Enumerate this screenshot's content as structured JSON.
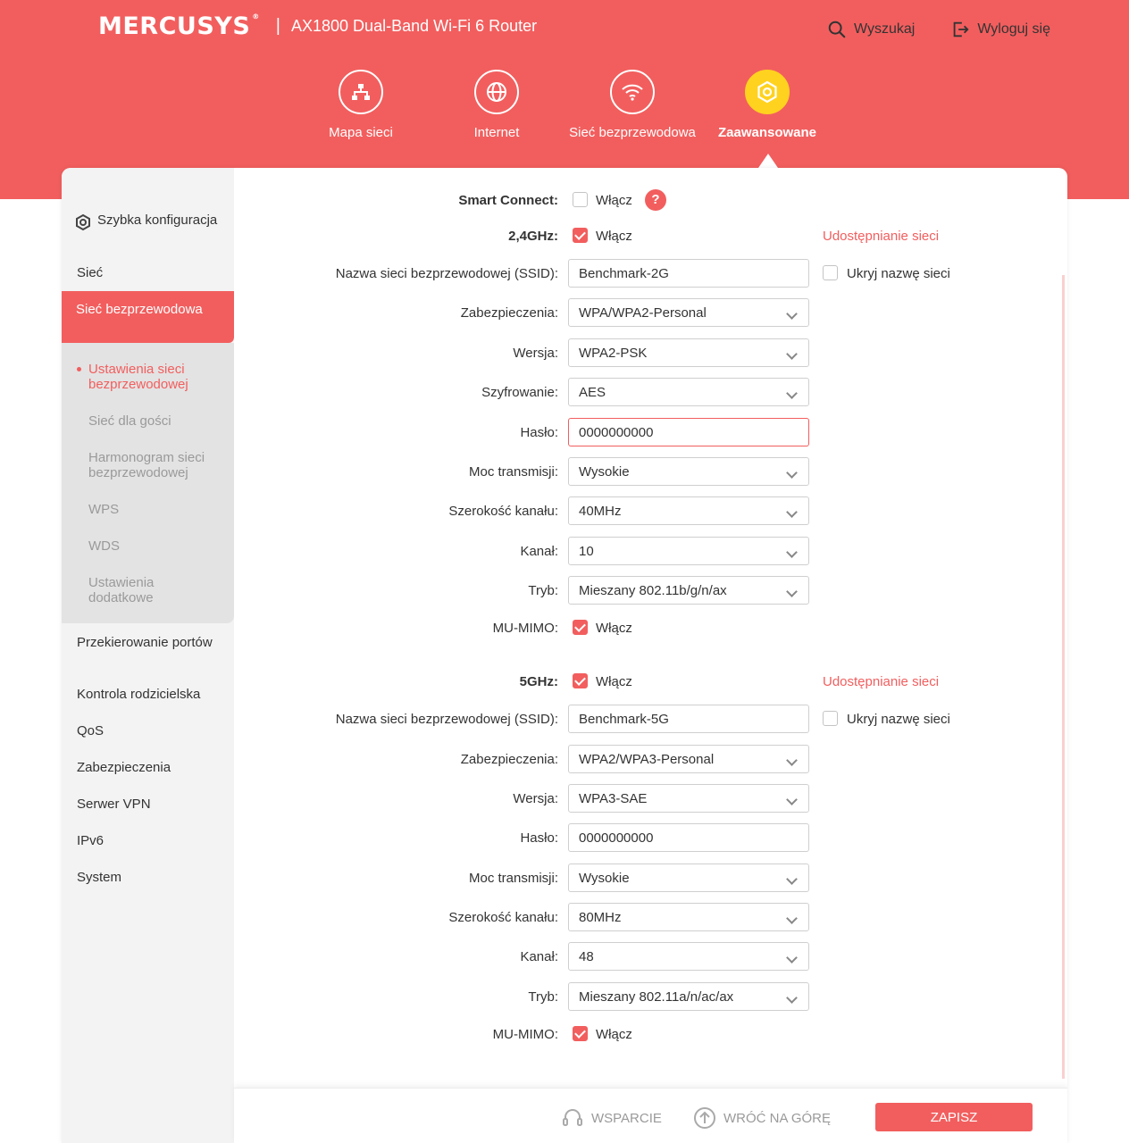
{
  "header": {
    "logo": "MERCUSYS",
    "product": "AX1800 Dual-Band Wi-Fi 6 Router",
    "search": "Wyszukaj",
    "logout": "Wyloguj się"
  },
  "nav": [
    {
      "label": "Mapa sieci",
      "icon": "network-map-icon"
    },
    {
      "label": "Internet",
      "icon": "globe-icon"
    },
    {
      "label": "Sieć bezprzewodowa",
      "icon": "wifi-icon"
    },
    {
      "label": "Zaawansowane",
      "icon": "gear-icon",
      "active": true
    }
  ],
  "sidebar": {
    "quick_setup": "Szybka konfiguracja",
    "network": "Sieć",
    "wireless": "Sieć bezprzewodowa",
    "sub": [
      "Ustawienia sieci bezprzewodowej",
      "Sieć dla gości",
      "Harmonogram sieci bezprzewodowej",
      "WPS",
      "WDS",
      "Ustawienia dodatkowe"
    ],
    "items": [
      "Przekierowanie portów",
      "Kontrola rodzicielska",
      "QoS",
      "Zabezpieczenia",
      "Serwer VPN",
      "IPv6",
      "System"
    ]
  },
  "form": {
    "smart_connect": {
      "label": "Smart Connect:",
      "enable": "Włącz",
      "checked": false
    },
    "band24": {
      "label": "2,4GHz:",
      "enable": "Włącz",
      "checked": true,
      "share": "Udostępnianie sieci",
      "ssid_label": "Nazwa sieci bezprzewodowej (SSID):",
      "ssid": "Benchmark-2G",
      "hide_ssid": "Ukryj nazwę sieci",
      "security_label": "Zabezpieczenia:",
      "security": "WPA/WPA2-Personal",
      "version_label": "Wersja:",
      "version": "WPA2-PSK",
      "encryption_label": "Szyfrowanie:",
      "encryption": "AES",
      "password_label": "Hasło:",
      "password": "0000000000",
      "power_label": "Moc transmisji:",
      "power": "Wysokie",
      "width_label": "Szerokość kanału:",
      "width": "40MHz",
      "channel_label": "Kanał:",
      "channel": "10",
      "mode_label": "Tryb:",
      "mode": "Mieszany 802.11b/g/n/ax",
      "mumimo_label": "MU-MIMO:",
      "mumimo": "Włącz"
    },
    "band5": {
      "label": "5GHz:",
      "enable": "Włącz",
      "checked": true,
      "share": "Udostępnianie sieci",
      "ssid_label": "Nazwa sieci bezprzewodowej (SSID):",
      "ssid": "Benchmark-5G",
      "hide_ssid": "Ukryj nazwę sieci",
      "security_label": "Zabezpieczenia:",
      "security": "WPA2/WPA3-Personal",
      "version_label": "Wersja:",
      "version": "WPA3-SAE",
      "password_label": "Hasło:",
      "password": "0000000000",
      "power_label": "Moc transmisji:",
      "power": "Wysokie",
      "width_label": "Szerokość kanału:",
      "width": "80MHz",
      "channel_label": "Kanał:",
      "channel": "48",
      "mode_label": "Tryb:",
      "mode": "Mieszany 802.11a/n/ac/ax",
      "mumimo_label": "MU-MIMO:",
      "mumimo": "Włącz"
    }
  },
  "footer": {
    "support": "WSPARCIE",
    "back_to_top": "WRÓĆ NA GÓRĘ",
    "save": "ZAPISZ"
  },
  "colors": {
    "accent": "#f25e5e",
    "active_nav": "#ffd21f"
  }
}
